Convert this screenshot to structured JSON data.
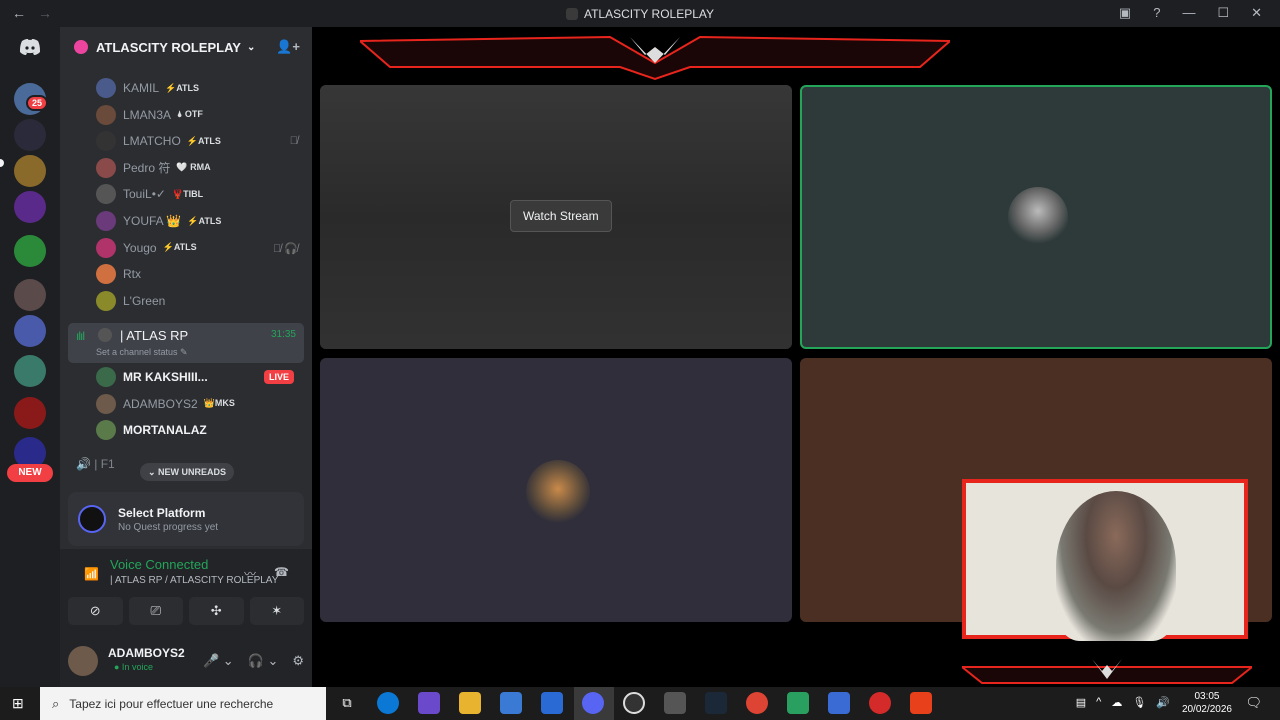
{
  "window": {
    "title": "ATLASCITY ROLEPLAY",
    "nav_back": "←",
    "nav_forward": "→",
    "inbox": "▣",
    "help": "?",
    "minimize": "—",
    "maximize": "☐",
    "close": "✕"
  },
  "rail": {
    "home_icon": "discord-icon",
    "badge_count": "25",
    "new_label": "NEW"
  },
  "server": {
    "name": "ATLASCITY ROLEPLAY",
    "chevron": "⌄",
    "add_user": "👤+"
  },
  "voice_users_top": [
    {
      "name": "KAMIL",
      "tag": "⚡ATLS",
      "color": "#4a5a8a"
    },
    {
      "name": "LMAN3A",
      "tag": "🌢 OTF",
      "color": "#6a4a3a"
    },
    {
      "name": "LMATCHO",
      "tag": "⚡ATLS",
      "color": "#333333"
    },
    {
      "name": "Pedro 符",
      "tag": "🤍 RMA",
      "color": "#8a4a4a"
    },
    {
      "name": "TouiL•✓",
      "tag": "🦞TIBL",
      "color": "#555555"
    },
    {
      "name": "YOUFA 👑",
      "tag": "⚡ATLS",
      "color": "#6a3a7a"
    },
    {
      "name": "Yougo",
      "tag": "⚡ATLS",
      "color": "#b0336a"
    },
    {
      "name": "Rtx",
      "tag": "",
      "color": "#d07040"
    },
    {
      "name": "L'Green",
      "tag": "",
      "color": "#8a8a2a"
    }
  ],
  "row_icons": {
    "lmatcho": "🎙̸",
    "yougo": "🎙̸ 🎧̸"
  },
  "channel": {
    "bars": "ılıl",
    "name": "| ATLAS RP",
    "time": "31:35",
    "status": "Set a channel status ✎"
  },
  "voice_users_chan": [
    {
      "name": "MR KAKSHIII...",
      "tag": "",
      "color": "#3a6a4a",
      "bright": true
    },
    {
      "name": "ADAMBOYS2",
      "tag": "👑MKS",
      "color": "#6d5a4a",
      "bright": false
    },
    {
      "name": "MORTANALAZ",
      "tag": "",
      "color": "#5a7a4a",
      "bright": true
    }
  ],
  "live_label": "LIVE",
  "next_channel": "🔊 | F1",
  "new_unreads": "⌄ NEW UNREADS",
  "quest": {
    "title": "Select Platform",
    "subtitle": "No Quest progress yet"
  },
  "voice": {
    "status": "Voice Connected",
    "location": "| ATLAS RP / ATLASCITY ROLEPLAY",
    "noise_icon": "〰",
    "disconnect_icon": "☎",
    "camera": "⊘",
    "screen": "⎚",
    "activity": "✣",
    "soundboard": "✶"
  },
  "user": {
    "name": "ADAMBOYS2",
    "status": "● In voice",
    "mic": "🎤 ⌄",
    "headset": "🎧 ⌄",
    "settings": "⚙"
  },
  "stream": {
    "watch_label": "Watch Stream"
  },
  "taskbar": {
    "search_placeholder": "Tapez ici pour effectuer une recherche",
    "time": "03:05",
    "date": "20/02/2026"
  },
  "colors": {
    "speaking_border": "#23a55a",
    "live_red": "#f23f43",
    "cam_frame": "#e8251d"
  }
}
